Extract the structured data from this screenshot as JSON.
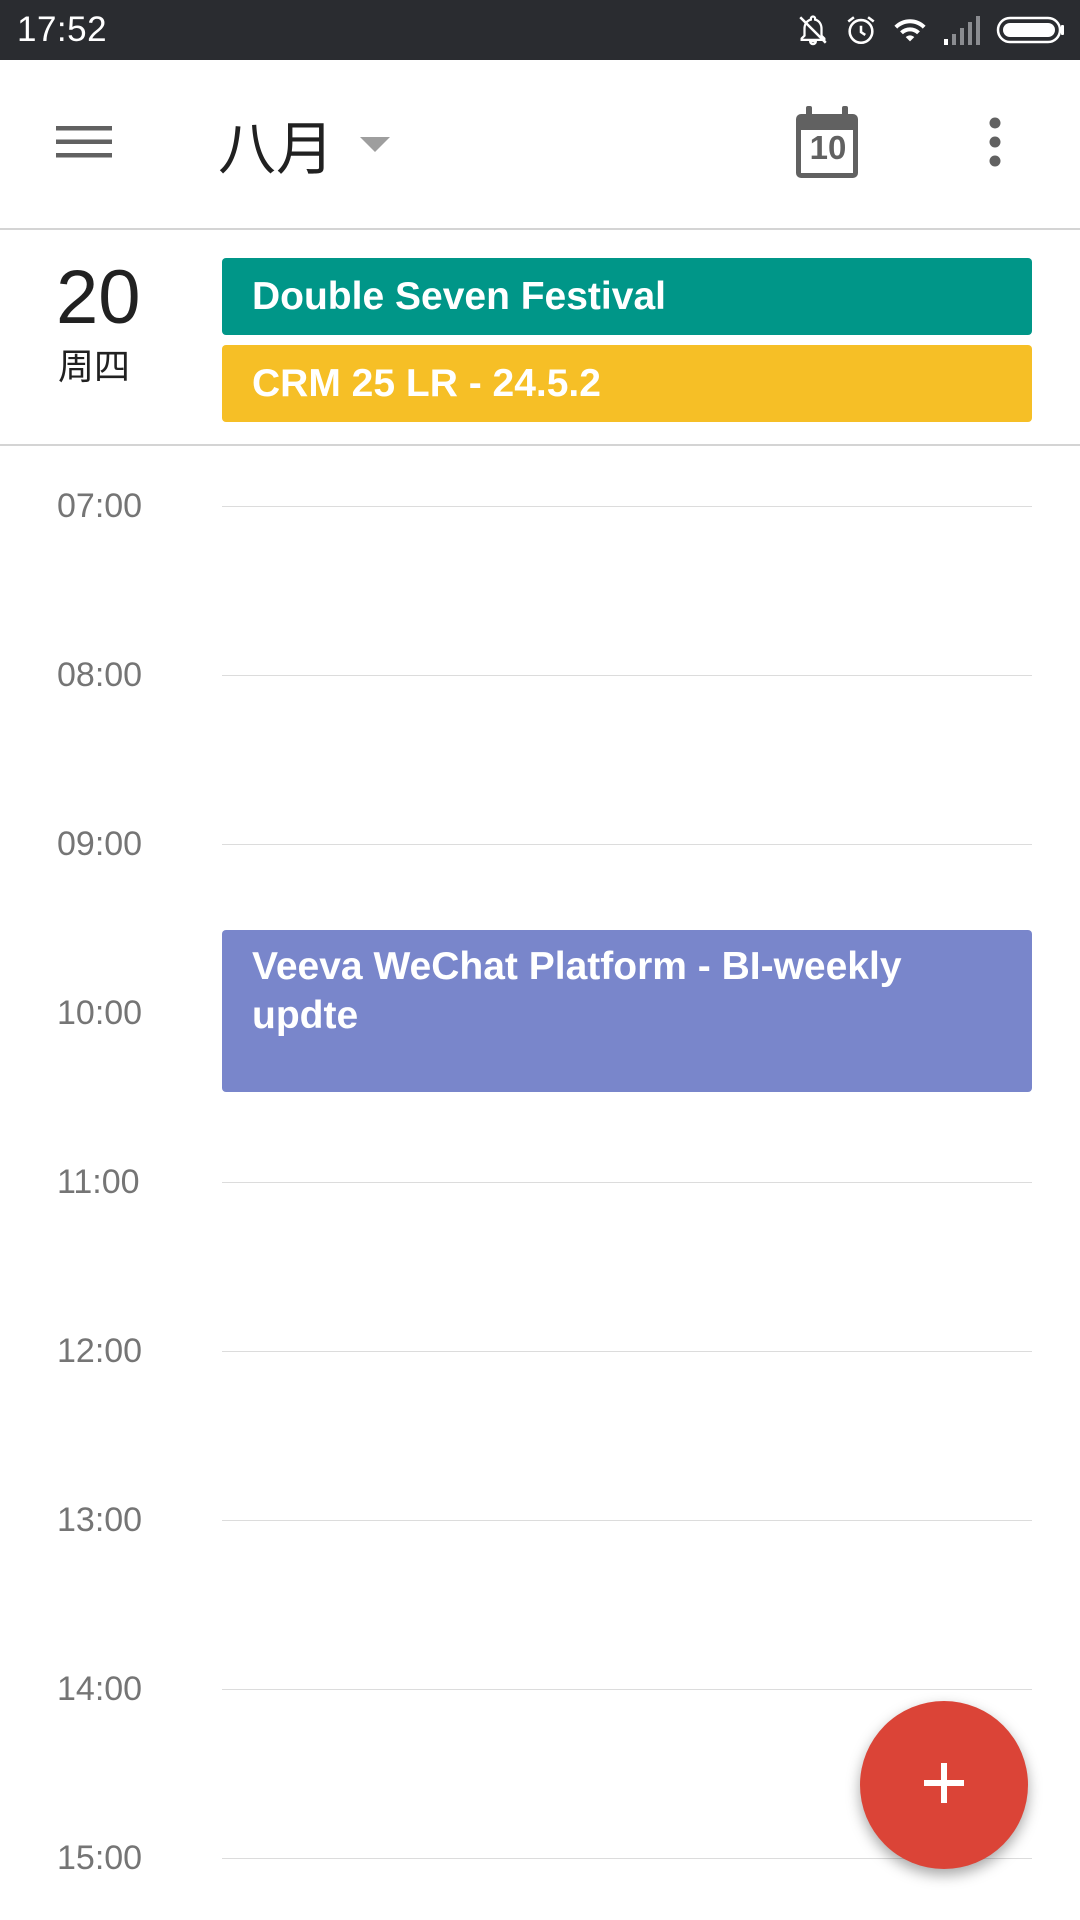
{
  "status_bar": {
    "time": "17:52",
    "icons": [
      "bell-off-icon",
      "alarm-icon",
      "wifi-icon",
      "signal-icon",
      "battery-icon"
    ]
  },
  "app_bar": {
    "menu_icon": "hamburger-menu-icon",
    "month": "八月",
    "dropdown_icon": "caret-down-icon",
    "today_icon": "calendar-today-icon",
    "today_number": "10",
    "overflow_icon": "more-vert-icon"
  },
  "day": {
    "number": "20",
    "weekday": "周四"
  },
  "all_day_events": [
    {
      "title": "Double Seven Festival",
      "color": "#009688"
    },
    {
      "title": "CRM 25 LR - 24.5.2",
      "color": "#f6bf26"
    }
  ],
  "hours": [
    "07:00",
    "08:00",
    "09:00",
    "10:00",
    "11:00",
    "12:00",
    "13:00",
    "14:00",
    "15:00"
  ],
  "timed_events": [
    {
      "title": "Veeva WeChat Platform - BI-weekly updte",
      "color": "#7986cb"
    }
  ],
  "fab": {
    "icon": "plus-icon",
    "color": "#db4437"
  }
}
